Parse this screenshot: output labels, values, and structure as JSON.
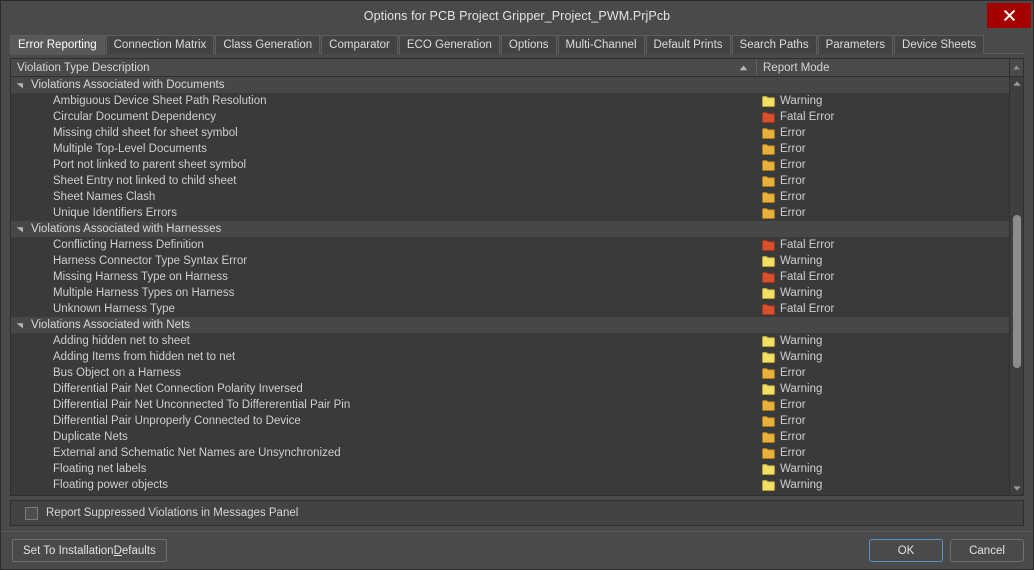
{
  "window": {
    "title": "Options for PCB Project Gripper_Project_PWM.PrjPcb",
    "close_icon": "close-icon",
    "accent_focus": "#5a93c8",
    "close_bg": "#a50000"
  },
  "tabs": [
    {
      "label": "Error Reporting",
      "active": true
    },
    {
      "label": "Connection Matrix",
      "active": false
    },
    {
      "label": "Class Generation",
      "active": false
    },
    {
      "label": "Comparator",
      "active": false
    },
    {
      "label": "ECO Generation",
      "active": false
    },
    {
      "label": "Options",
      "active": false
    },
    {
      "label": "Multi-Channel",
      "active": false
    },
    {
      "label": "Default Prints",
      "active": false
    },
    {
      "label": "Search Paths",
      "active": false
    },
    {
      "label": "Parameters",
      "active": false
    },
    {
      "label": "Device Sheets",
      "active": false
    }
  ],
  "grid": {
    "columns": [
      {
        "key": "description",
        "label": "Violation Type Description",
        "sort": "ascending"
      },
      {
        "key": "report_mode",
        "label": "Report Mode"
      }
    ],
    "sort_icon": "sort-ascending-icon",
    "groups": [
      {
        "label": "Violations Associated with Documents",
        "expanded": true,
        "rows": [
          {
            "description": "Ambiguous Device Sheet Path Resolution",
            "report_mode": "Warning",
            "icon": "warning-folder-icon"
          },
          {
            "description": "Circular Document Dependency",
            "report_mode": "Fatal Error",
            "icon": "fatal-error-folder-icon"
          },
          {
            "description": "Missing child sheet for sheet symbol",
            "report_mode": "Error",
            "icon": "error-folder-icon"
          },
          {
            "description": "Multiple Top-Level Documents",
            "report_mode": "Error",
            "icon": "error-folder-icon"
          },
          {
            "description": "Port not linked to parent sheet symbol",
            "report_mode": "Error",
            "icon": "error-folder-icon"
          },
          {
            "description": "Sheet Entry not linked to child sheet",
            "report_mode": "Error",
            "icon": "error-folder-icon"
          },
          {
            "description": "Sheet Names Clash",
            "report_mode": "Error",
            "icon": "error-folder-icon"
          },
          {
            "description": "Unique Identifiers Errors",
            "report_mode": "Error",
            "icon": "error-folder-icon"
          }
        ]
      },
      {
        "label": "Violations Associated with Harnesses",
        "expanded": true,
        "rows": [
          {
            "description": "Conflicting Harness Definition",
            "report_mode": "Fatal Error",
            "icon": "fatal-error-folder-icon"
          },
          {
            "description": "Harness Connector Type Syntax Error",
            "report_mode": "Warning",
            "icon": "warning-folder-icon"
          },
          {
            "description": "Missing Harness Type on Harness",
            "report_mode": "Fatal Error",
            "icon": "fatal-error-folder-icon"
          },
          {
            "description": "Multiple Harness Types on Harness",
            "report_mode": "Warning",
            "icon": "warning-folder-icon"
          },
          {
            "description": "Unknown Harness Type",
            "report_mode": "Fatal Error",
            "icon": "fatal-error-folder-icon"
          }
        ]
      },
      {
        "label": "Violations Associated with Nets",
        "expanded": true,
        "rows": [
          {
            "description": "Adding hidden net to sheet",
            "report_mode": "Warning",
            "icon": "warning-folder-icon"
          },
          {
            "description": "Adding Items from hidden net to net",
            "report_mode": "Warning",
            "icon": "warning-folder-icon"
          },
          {
            "description": "Bus Object on a Harness",
            "report_mode": "Error",
            "icon": "error-folder-icon"
          },
          {
            "description": "Differential Pair Net Connection Polarity Inversed",
            "report_mode": "Warning",
            "icon": "warning-folder-icon"
          },
          {
            "description": "Differential Pair Net Unconnected To Differerential Pair Pin",
            "report_mode": "Error",
            "icon": "error-folder-icon"
          },
          {
            "description": "Differential Pair Unproperly Connected to Device",
            "report_mode": "Error",
            "icon": "error-folder-icon"
          },
          {
            "description": "Duplicate Nets",
            "report_mode": "Error",
            "icon": "error-folder-icon"
          },
          {
            "description": "External and Schematic Net Names are Unsynchronized",
            "report_mode": "Error",
            "icon": "error-folder-icon"
          },
          {
            "description": "Floating net labels",
            "report_mode": "Warning",
            "icon": "warning-folder-icon"
          },
          {
            "description": "Floating power objects",
            "report_mode": "Warning",
            "icon": "warning-folder-icon"
          }
        ]
      }
    ],
    "scrollbar": {
      "up_icon": "scroll-up-icon",
      "down_icon": "scroll-down-icon",
      "thumb_top_pct": 32,
      "thumb_height_pct": 39
    }
  },
  "suppress": {
    "label": "Report Suppressed Violations in Messages Panel",
    "checked": false
  },
  "footer": {
    "defaults_prefix": "Set To Installation ",
    "defaults_accel": "D",
    "defaults_suffix": "efaults",
    "ok_label": "OK",
    "cancel_label": "Cancel"
  },
  "icon_colors": {
    "warning_folder": "#f2de69",
    "error_folder": "#e8b23a",
    "fatal_error_folder": "#d9502e"
  }
}
